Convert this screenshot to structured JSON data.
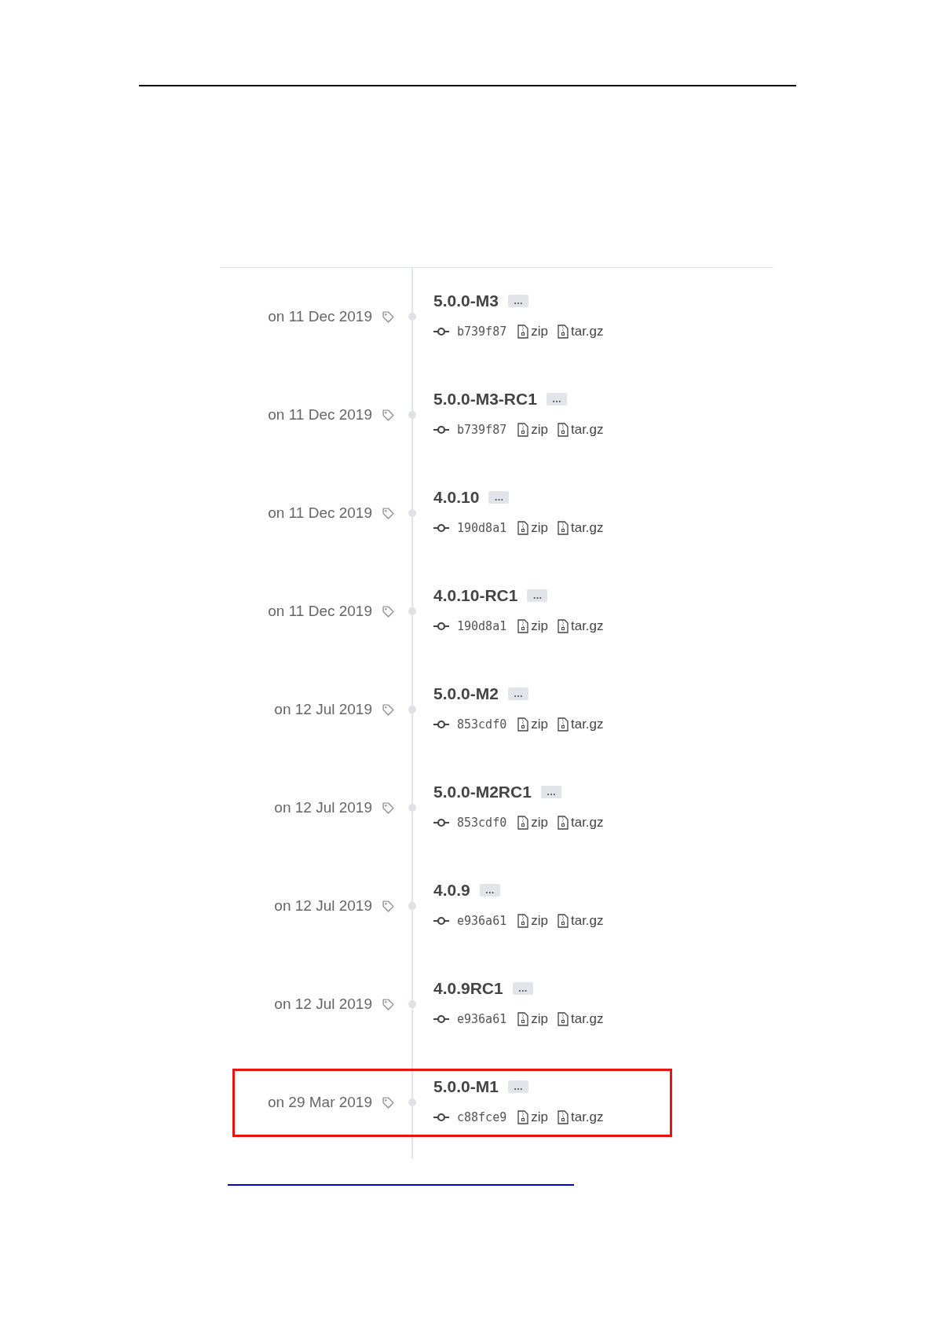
{
  "tags": [
    {
      "date": "on 11 Dec 2019",
      "name": "5.0.0-M3",
      "more": "…",
      "commit": "b739f87",
      "downloads": [
        "zip",
        "tar.gz"
      ],
      "highlighted": false
    },
    {
      "date": "on 11 Dec 2019",
      "name": "5.0.0-M3-RC1",
      "more": "…",
      "commit": "b739f87",
      "downloads": [
        "zip",
        "tar.gz"
      ],
      "highlighted": false
    },
    {
      "date": "on 11 Dec 2019",
      "name": "4.0.10",
      "more": "…",
      "commit": "190d8a1",
      "downloads": [
        "zip",
        "tar.gz"
      ],
      "highlighted": false
    },
    {
      "date": "on 11 Dec 2019",
      "name": "4.0.10-RC1",
      "more": "…",
      "commit": "190d8a1",
      "downloads": [
        "zip",
        "tar.gz"
      ],
      "highlighted": false
    },
    {
      "date": "on 12 Jul 2019",
      "name": "5.0.0-M2",
      "more": "…",
      "commit": "853cdf0",
      "downloads": [
        "zip",
        "tar.gz"
      ],
      "highlighted": false
    },
    {
      "date": "on 12 Jul 2019",
      "name": "5.0.0-M2RC1",
      "more": "…",
      "commit": "853cdf0",
      "downloads": [
        "zip",
        "tar.gz"
      ],
      "highlighted": false
    },
    {
      "date": "on 12 Jul 2019",
      "name": "4.0.9",
      "more": "…",
      "commit": "e936a61",
      "downloads": [
        "zip",
        "tar.gz"
      ],
      "highlighted": false
    },
    {
      "date": "on 12 Jul 2019",
      "name": "4.0.9RC1",
      "more": "…",
      "commit": "e936a61",
      "downloads": [
        "zip",
        "tar.gz"
      ],
      "highlighted": false
    },
    {
      "date": "on 29 Mar 2019",
      "name": "5.0.0-M1",
      "more": "…",
      "commit": "c88fce9",
      "downloads": [
        "zip",
        "tar.gz"
      ],
      "highlighted": true
    }
  ]
}
